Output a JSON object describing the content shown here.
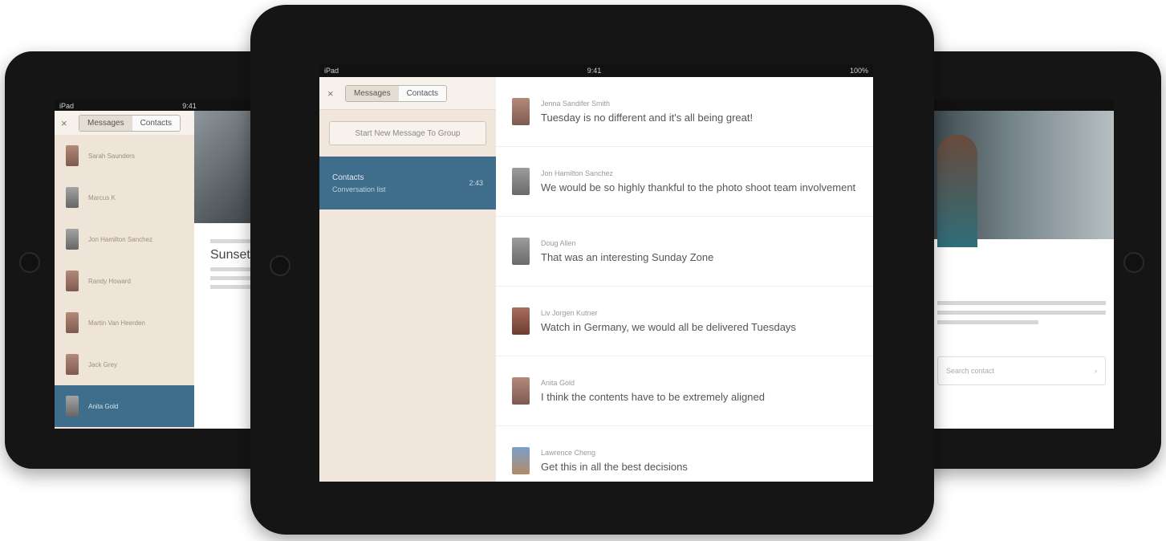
{
  "center": {
    "statusbar": {
      "left": "iPad",
      "center": "9:41",
      "right": "100%"
    },
    "sidebar": {
      "close_icon": "×",
      "tabs": [
        "Messages",
        "Contacts"
      ],
      "new_message_button": "Start New Message To Group",
      "active_conversation": {
        "title": "Contacts",
        "subtitle": "Conversation list",
        "badge": "2:43"
      }
    },
    "messages": [
      {
        "sender": "Jenna Sandifer Smith",
        "text": "Tuesday is no different and it's all being great!"
      },
      {
        "sender": "Jon Hamilton Sanchez",
        "text": "We would be so highly thankful to the photo shoot team involvement"
      },
      {
        "sender": "Doug Allen",
        "text": "That was an interesting Sunday Zone"
      },
      {
        "sender": "Liv Jorgen Kutner",
        "text": "Watch in Germany, we would all be delivered Tuesdays"
      },
      {
        "sender": "Anita Gold",
        "text": "I think the contents have to be extremely aligned"
      },
      {
        "sender": "Lawrence Cheng",
        "text": "Get this in all the best decisions"
      }
    ]
  },
  "left": {
    "statusbar": {
      "left": "iPad",
      "center": "9:41",
      "right": ""
    },
    "tabs": [
      "Messages",
      "Contacts"
    ],
    "contacts": [
      "Sarah Saunders",
      "Marcus K",
      "Jon Hamilton Sanchez",
      "Randy Howard",
      "Martin Van Heerden",
      "Jack Grey",
      "Anita Gold"
    ],
    "article": {
      "title": "Sunset"
    }
  },
  "right": {
    "input_placeholder": "Search contact",
    "chevron": "›"
  }
}
